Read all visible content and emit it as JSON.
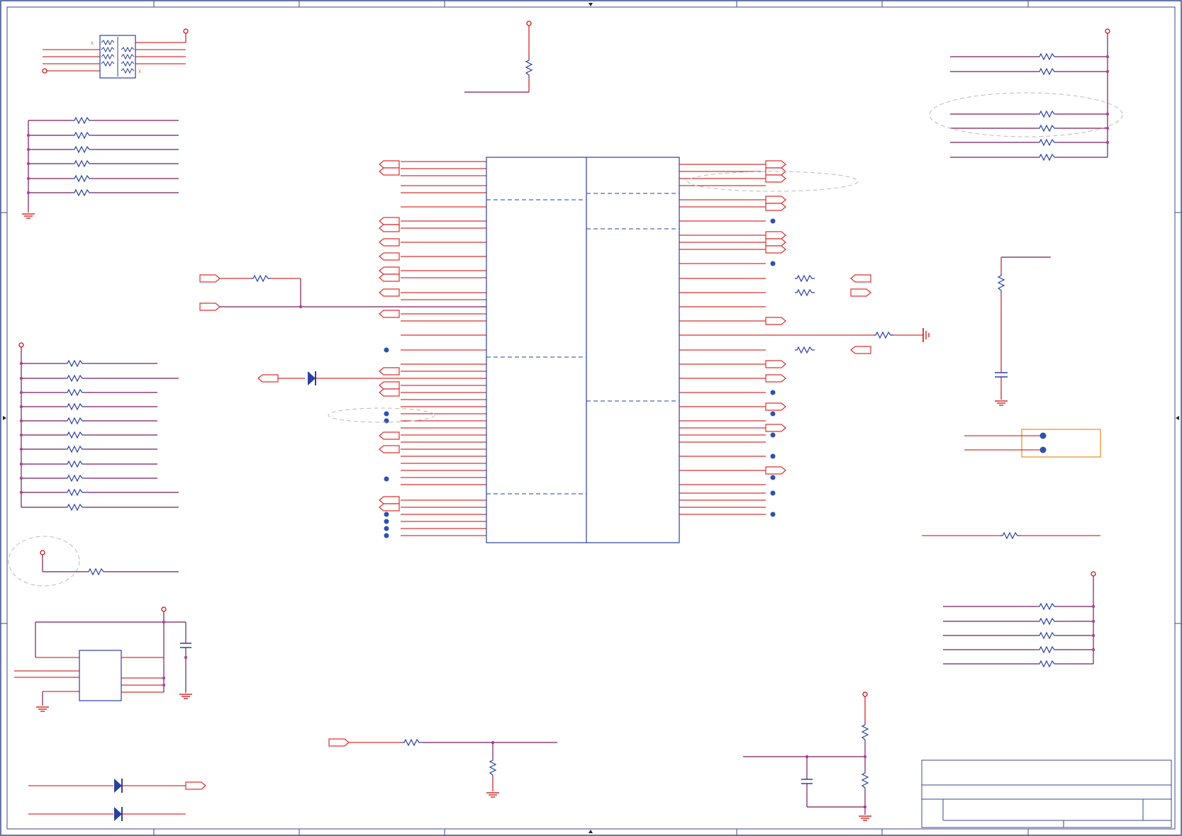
{
  "schematic": {
    "colors": {
      "wire": "#cc0000",
      "net": "#7a1a5a",
      "component": "#2b3fa0",
      "junction": "#3050b0",
      "port": "#e03030",
      "border": "#3a4a8a",
      "highlight_box": "#ee8822",
      "annotation": "#bbbbbb"
    },
    "labels": {
      "title_block": ""
    },
    "icons": [
      "resistor-icon",
      "capacitor-icon",
      "diode-icon",
      "ground-icon",
      "power-port-icon",
      "off-page-connector-icon",
      "junction-dot-icon"
    ]
  }
}
